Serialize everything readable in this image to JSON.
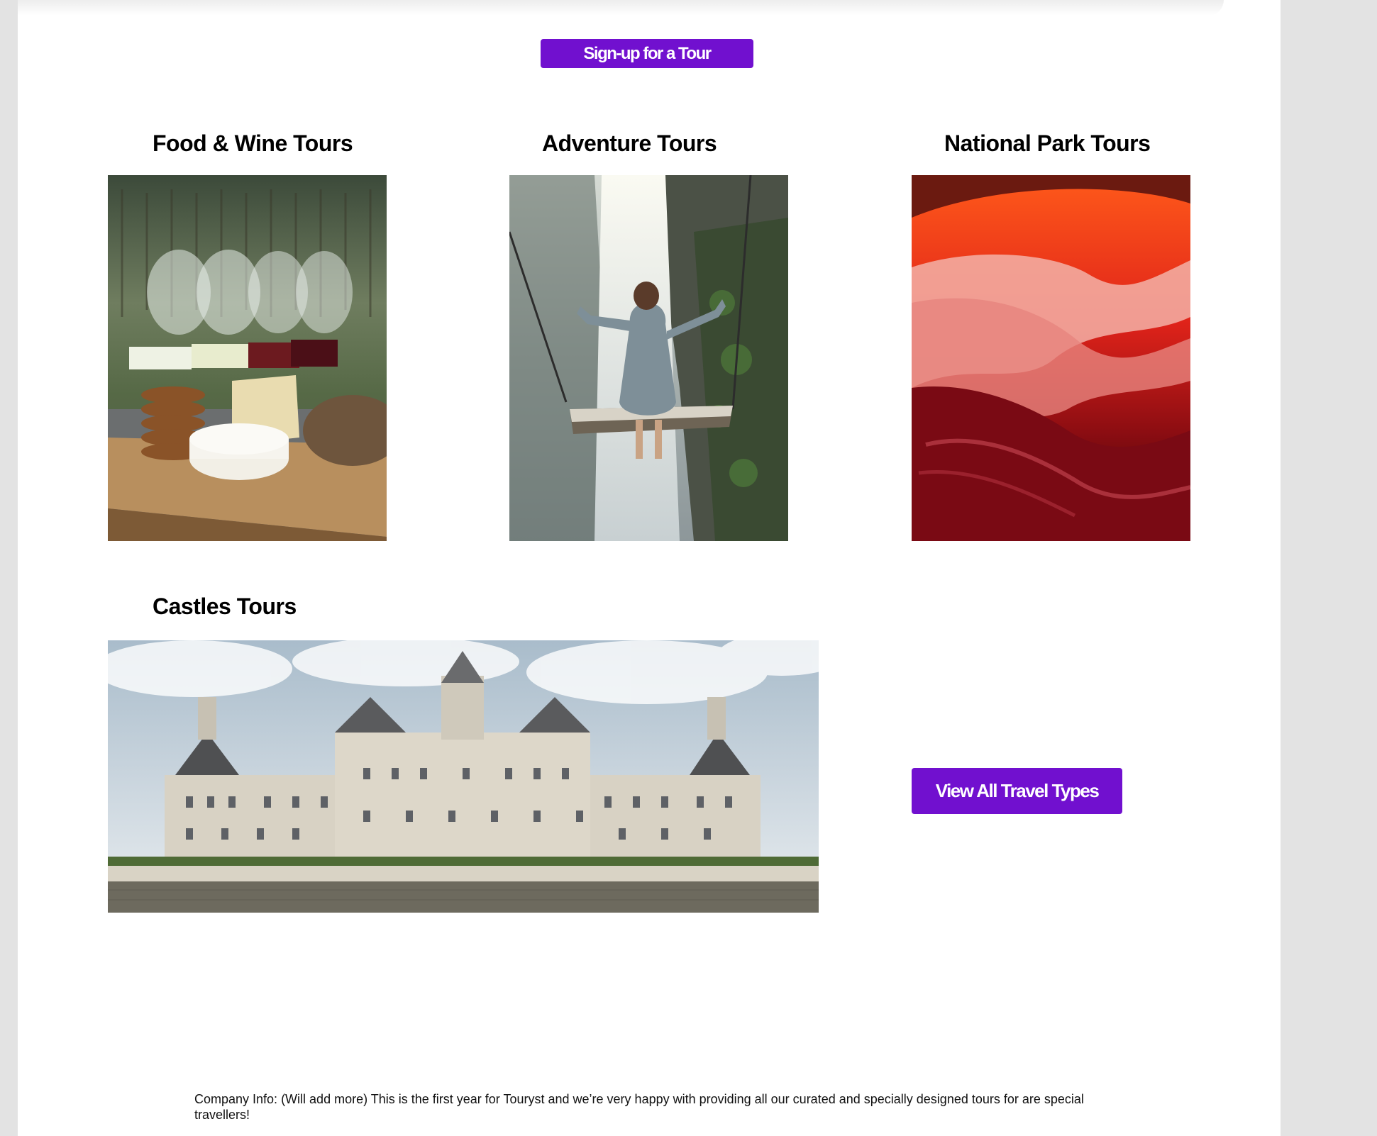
{
  "header": {
    "signup_label": "Sign-up for a Tour"
  },
  "tours": {
    "food_wine": {
      "title": "Food & Wine Tours"
    },
    "adventure": {
      "title": "Adventure Tours"
    },
    "national_park": {
      "title": "National Park Tours"
    },
    "castles": {
      "title": "Castles Tours"
    }
  },
  "cta": {
    "view_all_label": "View All Travel Types"
  },
  "footer": {
    "company_info": "Company Info: (Will add more) This is the first year for Touryst and we’re very happy with providing all our curated and specially designed  tours for are special travellers!"
  },
  "colors": {
    "accent": "#7110cf",
    "page_background": "#ffffff",
    "outer_background": "#e3e3e3"
  }
}
